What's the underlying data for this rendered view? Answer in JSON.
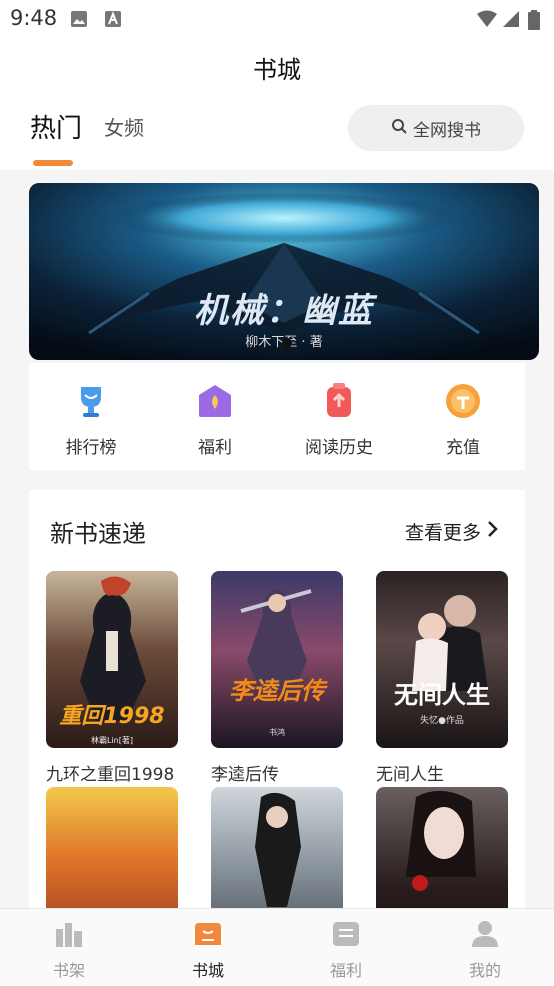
{
  "status_bar": {
    "time": "9:48"
  },
  "header": {
    "title": "书城"
  },
  "tabs": {
    "hot": "热门",
    "female": "女频"
  },
  "search": {
    "label": "全网搜书"
  },
  "banner": {
    "title": "机械：幽蓝",
    "author": "柳木下至 · 著"
  },
  "quick_links": [
    {
      "label": "排行榜",
      "icon": "trophy-icon",
      "color": "#4a9bea"
    },
    {
      "label": "福利",
      "icon": "gift-icon",
      "color": "#9b6be6"
    },
    {
      "label": "阅读历史",
      "icon": "history-icon",
      "color": "#f25a5a"
    },
    {
      "label": "充值",
      "icon": "coin-icon",
      "color": "#f7a13a"
    }
  ],
  "new_books": {
    "title": "新书速递",
    "more_label": "查看更多",
    "books": [
      {
        "name": "九环之重回1998",
        "cover_text": "重回1998",
        "cover_author": "林霸Lin[著]"
      },
      {
        "name": "李逵后传",
        "cover_text": "李逵后传",
        "cover_author": "书鸿"
      },
      {
        "name": "无间人生",
        "cover_text": "无间人生",
        "cover_author": "失忆●作品"
      }
    ]
  },
  "bottom_nav": [
    {
      "label": "书架",
      "icon": "bookshelf-icon"
    },
    {
      "label": "书城",
      "icon": "store-icon",
      "active": true
    },
    {
      "label": "福利",
      "icon": "welfare-icon"
    },
    {
      "label": "我的",
      "icon": "profile-icon"
    }
  ],
  "colors": {
    "accent": "#f08a3a",
    "page_bg": "#f5f5f5"
  }
}
